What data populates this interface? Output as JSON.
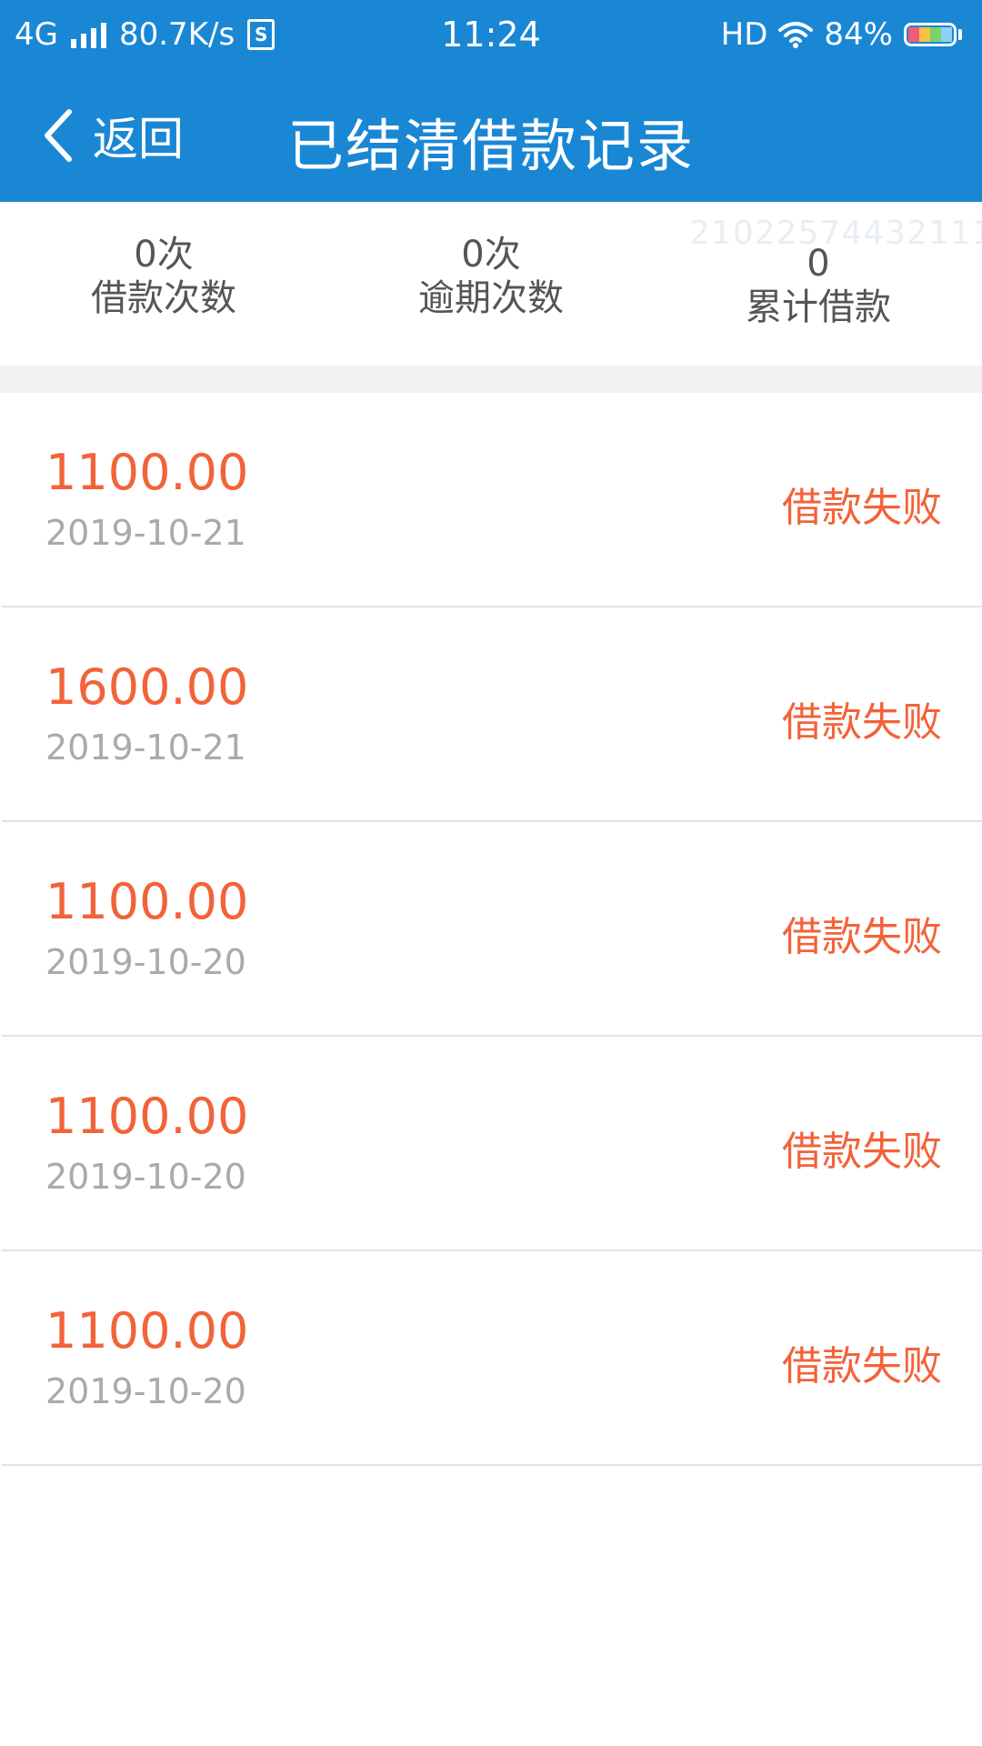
{
  "status_bar": {
    "network": "4G",
    "speed": "80.7K/s",
    "sim_label": "S",
    "time": "11:24",
    "hd": "HD",
    "battery": "84%"
  },
  "navbar": {
    "back_label": "返回",
    "title": "已结清借款记录"
  },
  "stats": {
    "loan_count_value": "0次",
    "loan_count_label": "借款次数",
    "overdue_value": "0次",
    "overdue_label": "逾期次数",
    "total_value": "0",
    "total_label": "累计借款",
    "watermark": "21022574432111"
  },
  "records": [
    {
      "amount": "1100.00",
      "date": "2019-10-21",
      "status": "借款失败"
    },
    {
      "amount": "1600.00",
      "date": "2019-10-21",
      "status": "借款失败"
    },
    {
      "amount": "1100.00",
      "date": "2019-10-20",
      "status": "借款失败"
    },
    {
      "amount": "1100.00",
      "date": "2019-10-20",
      "status": "借款失败"
    },
    {
      "amount": "1100.00",
      "date": "2019-10-20",
      "status": "借款失败"
    }
  ],
  "colors": {
    "header": "#1a87d5",
    "accent": "#f2633a",
    "muted": "#aaaaaa"
  }
}
